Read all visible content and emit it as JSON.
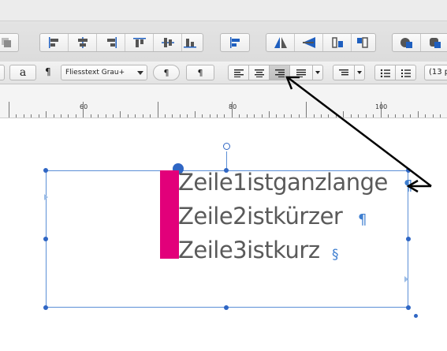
{
  "toolbar2": {
    "char_style_label": "a",
    "para_mark_label": "¶",
    "para_style_value": "Fliesstext Grau+",
    "para_btn1": "¶",
    "para_btn2": "¶",
    "size_value": "(13 p"
  },
  "ruler": {
    "labels": [
      "60",
      "80",
      "100"
    ]
  },
  "text_lines": [
    "Zeile1istganzlange",
    "Zeile2istkürzer",
    "Zeile3istkurz"
  ],
  "marks": {
    "pilcrow": "¶",
    "section": "§"
  },
  "colors": {
    "accent": "#e2007a",
    "selection": "#2f66c4",
    "annotation": "#000000"
  },
  "annotation": {
    "arrow_points_to": "align-right-button"
  }
}
